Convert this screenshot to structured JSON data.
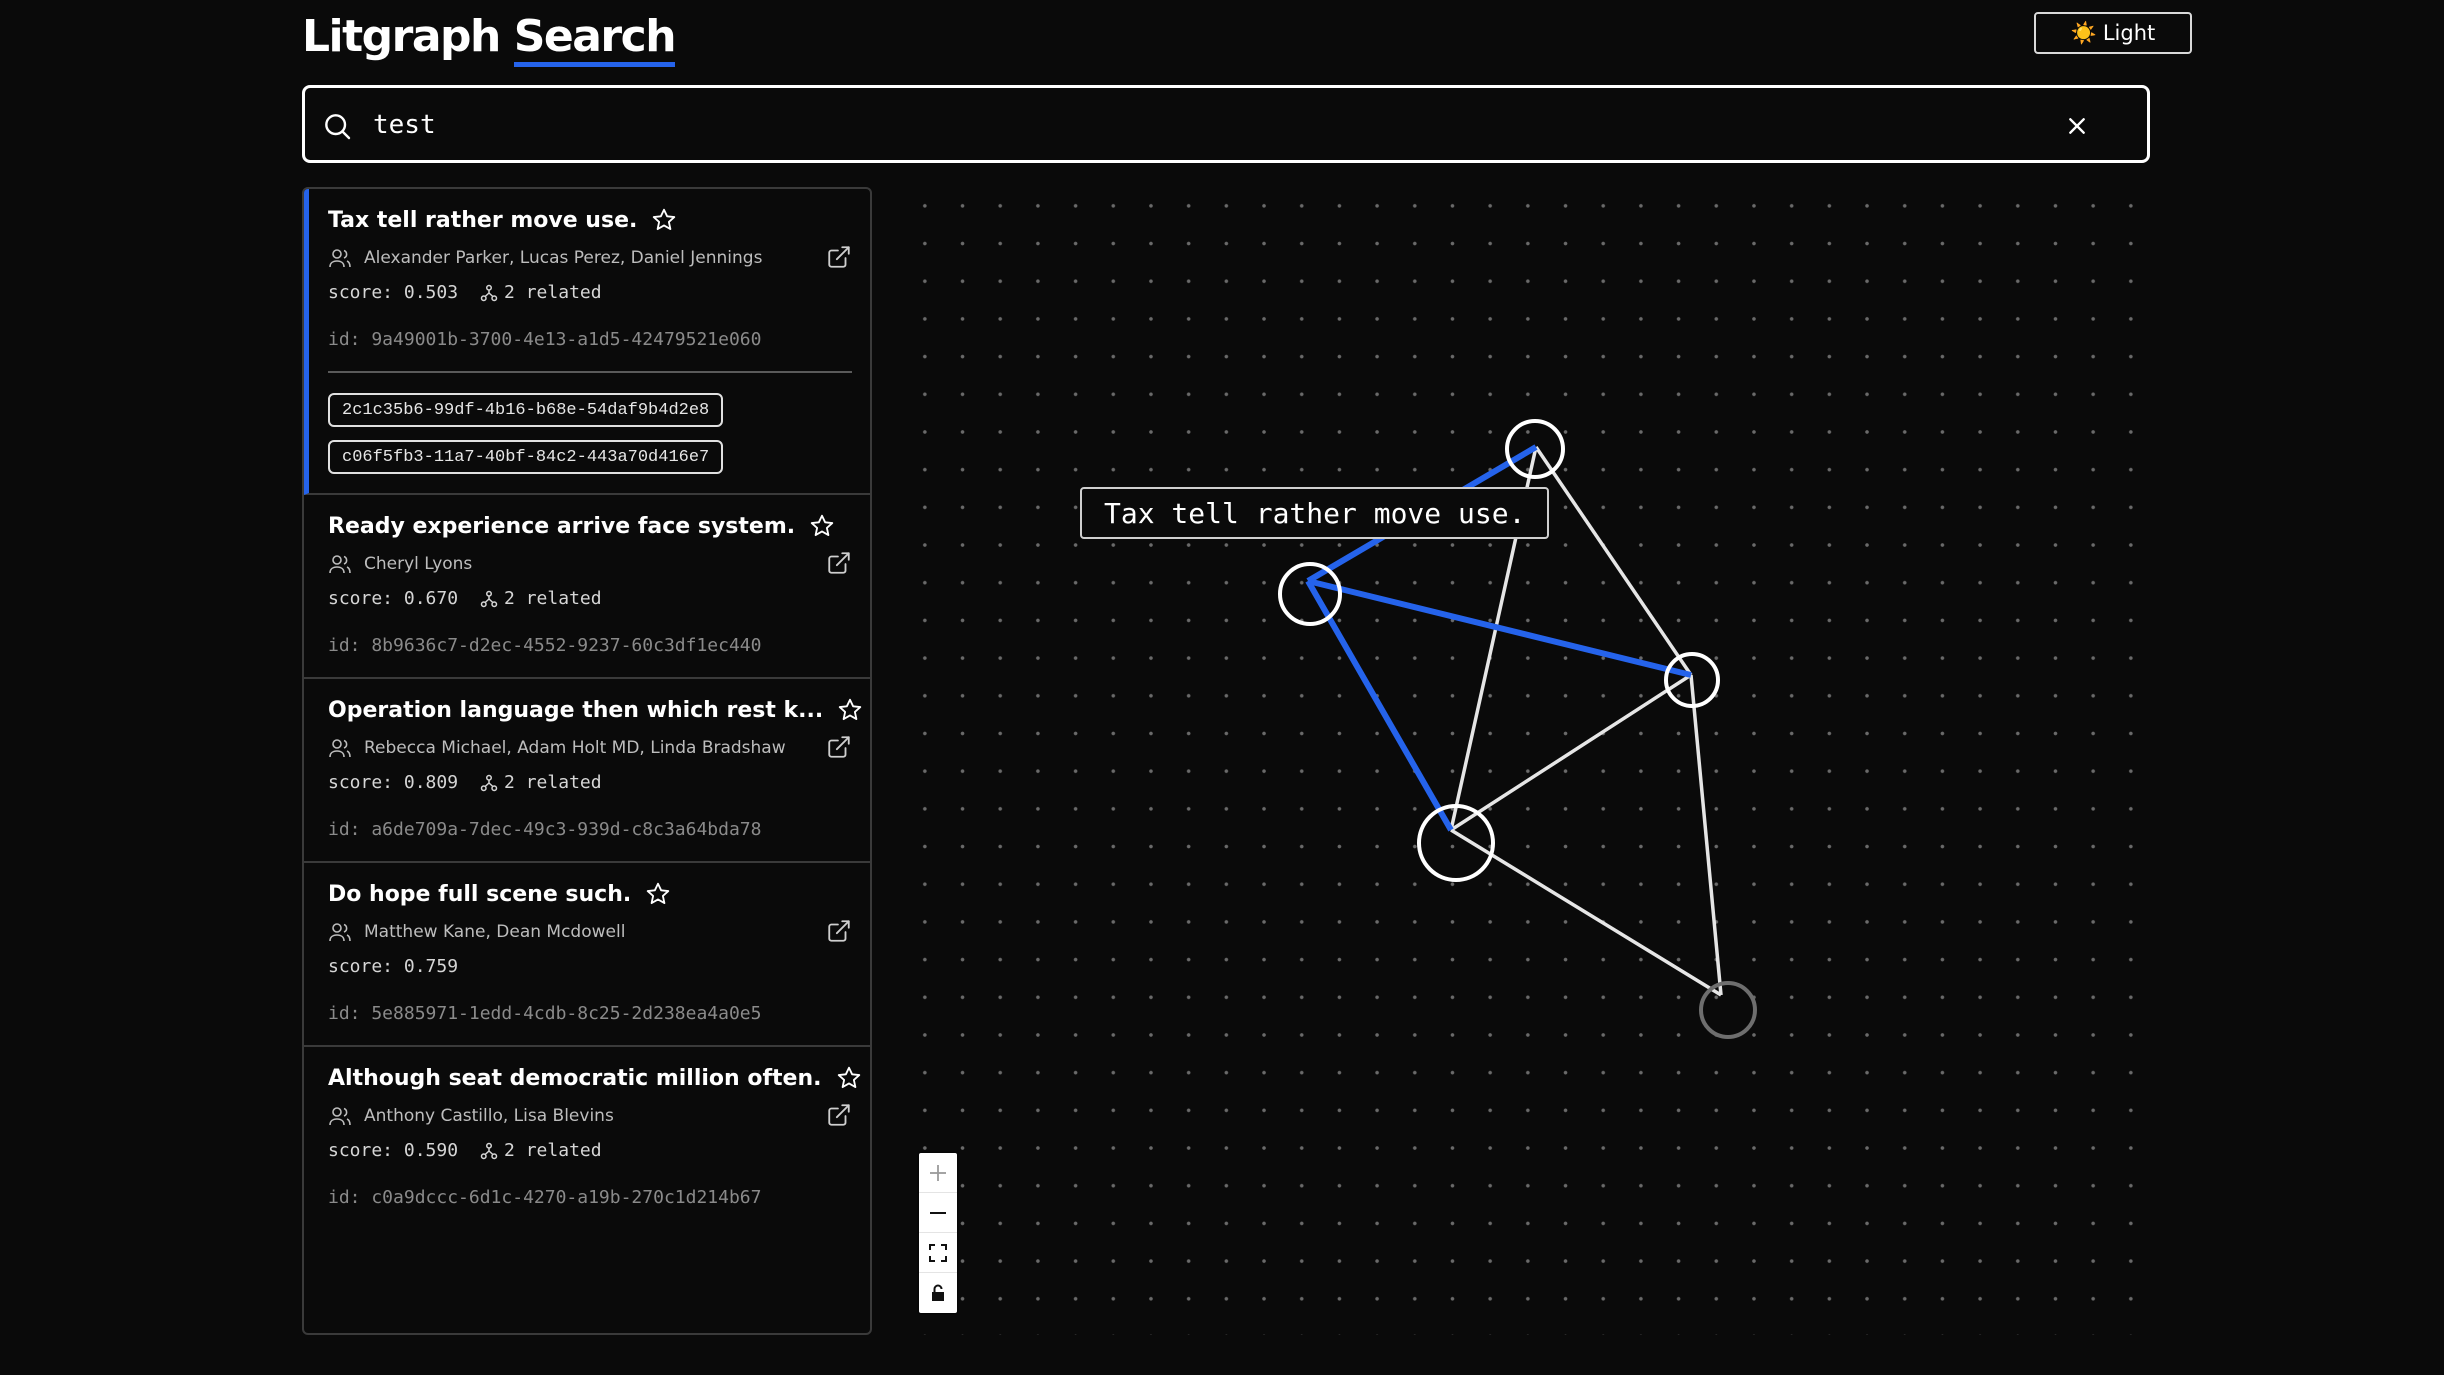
{
  "app": {
    "title_part1": "Litgraph",
    "title_part2": "Search",
    "theme_button_icon": "☀️",
    "theme_button_label": "Light"
  },
  "search": {
    "value": "test",
    "placeholder": ""
  },
  "results": [
    {
      "title": "Tax tell rather move use.",
      "authors": "Alexander Parker, Lucas Perez, Daniel Jennings",
      "score": "score: 0.503",
      "related": "2 related",
      "id": "id: 9a49001b-3700-4e13-a1d5-42479521e060",
      "related_ids": [
        "2c1c35b6-99df-4b16-b68e-54daf9b4d2e8",
        "c06f5fb3-11a7-40bf-84c2-443a70d416e7"
      ]
    },
    {
      "title": "Ready experience arrive face system.",
      "authors": "Cheryl Lyons",
      "score": "score: 0.670",
      "related": "2 related",
      "id": "id: 8b9636c7-d2ec-4552-9237-60c3df1ec440"
    },
    {
      "title": "Operation language then which rest k...",
      "authors": "Rebecca Michael, Adam Holt MD, Linda Bradshaw",
      "score": "score: 0.809",
      "related": "2 related",
      "id": "id: a6de709a-7dec-49c3-939d-c8c3a64bda78"
    },
    {
      "title": "Do hope full scene such.",
      "authors": "Matthew Kane, Dean Mcdowell",
      "score": "score: 0.759",
      "related": "",
      "id": "id: 5e885971-1edd-4cdb-8c25-2d238ea4a0e5"
    },
    {
      "title": "Although seat democratic million often.",
      "authors": "Anthony Castillo, Lisa Blevins",
      "score": "score: 0.590",
      "related": "2 related",
      "id": "id: c0a9dccc-6d1c-4270-a19b-270c1d214b67"
    }
  ],
  "graph": {
    "tooltip": "Tax tell rather move use.",
    "highlight_color": "#2563eb",
    "edge_color": "#e6e6e6",
    "controls": [
      "zoom-in",
      "zoom-out",
      "fit-view",
      "lock"
    ]
  },
  "colors": {
    "background": "#0a0a0a",
    "accent": "#2563eb",
    "border": "#3a3a3a"
  }
}
